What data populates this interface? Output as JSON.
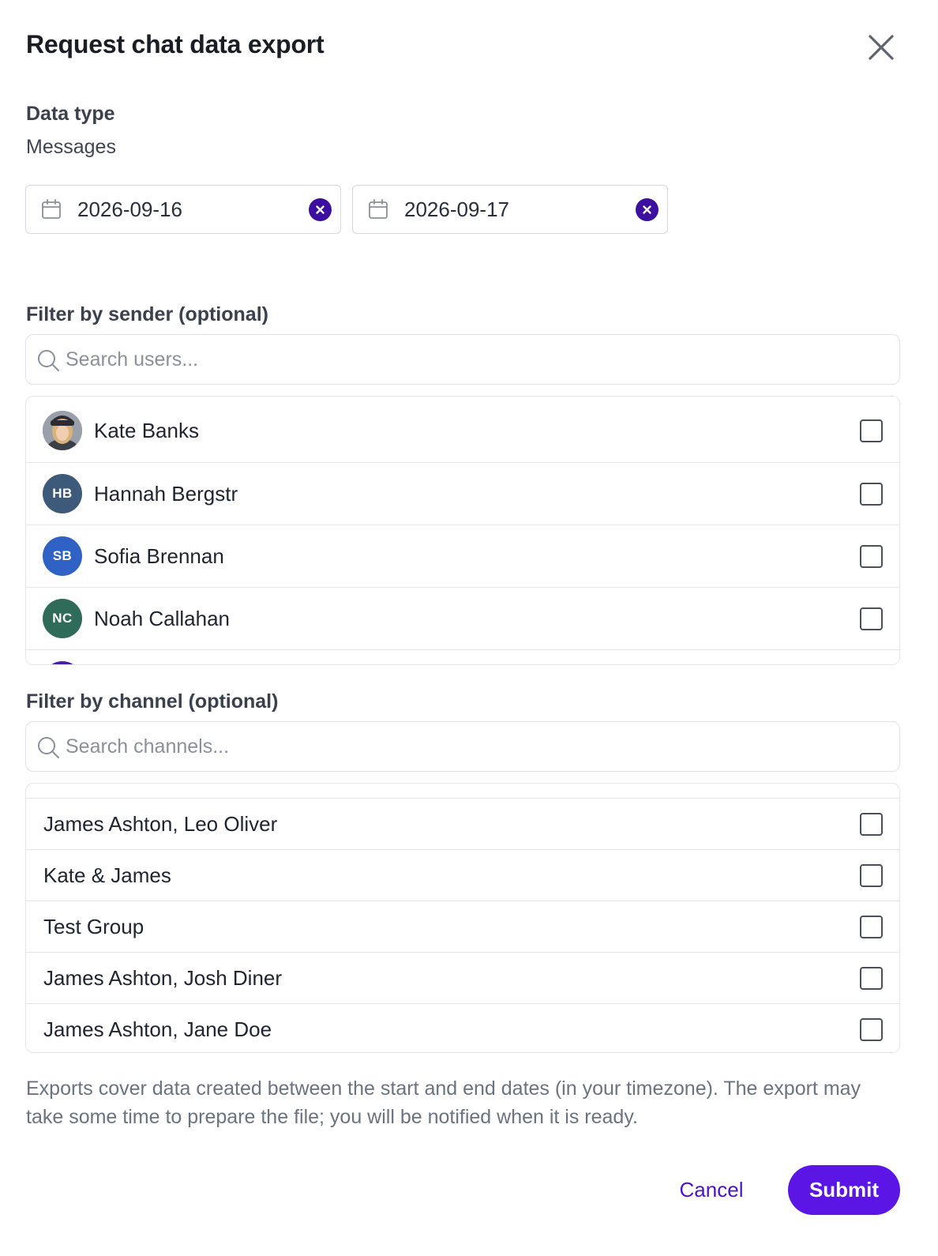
{
  "dialog": {
    "title": "Request chat data export"
  },
  "data_type": {
    "label": "Data type",
    "value": "Messages"
  },
  "date_range": {
    "start": "2026-09-16",
    "end": "2026-09-17"
  },
  "sender_filter": {
    "label": "Filter by sender (optional)",
    "search_placeholder": "Search users...",
    "users": [
      {
        "name": "Kate Banks",
        "initials": "",
        "avatar": "photo",
        "color": "#6b6f78",
        "checked": false
      },
      {
        "name": "Hannah Bergstr",
        "initials": "HB",
        "avatar": "initials",
        "color": "#3d5a7a",
        "checked": false
      },
      {
        "name": "Sofia Brennan",
        "initials": "SB",
        "avatar": "initials",
        "color": "#2f62c4",
        "checked": false
      },
      {
        "name": "Noah Callahan",
        "initials": "NC",
        "avatar": "initials",
        "color": "#2e6b58",
        "checked": false
      }
    ]
  },
  "channel_filter": {
    "label": "Filter by channel (optional)",
    "search_placeholder": "Search channels...",
    "channels": [
      {
        "name": "James Ashton, Leo Oliver",
        "checked": false
      },
      {
        "name": "Kate & James",
        "checked": false
      },
      {
        "name": "Test Group",
        "checked": false
      },
      {
        "name": "James Ashton, Josh Diner",
        "checked": false
      },
      {
        "name": "James Ashton, Jane Doe",
        "checked": false
      }
    ]
  },
  "footnote": "Exports cover data created between the start and end dates (in your timezone). The export may take some time to prepare the file; you will be notified when it is ready.",
  "actions": {
    "cancel": "Cancel",
    "submit": "Submit"
  },
  "colors": {
    "accent": "#5b16e6",
    "clear_button": "#3d0fa0",
    "link": "#4c14c8"
  }
}
